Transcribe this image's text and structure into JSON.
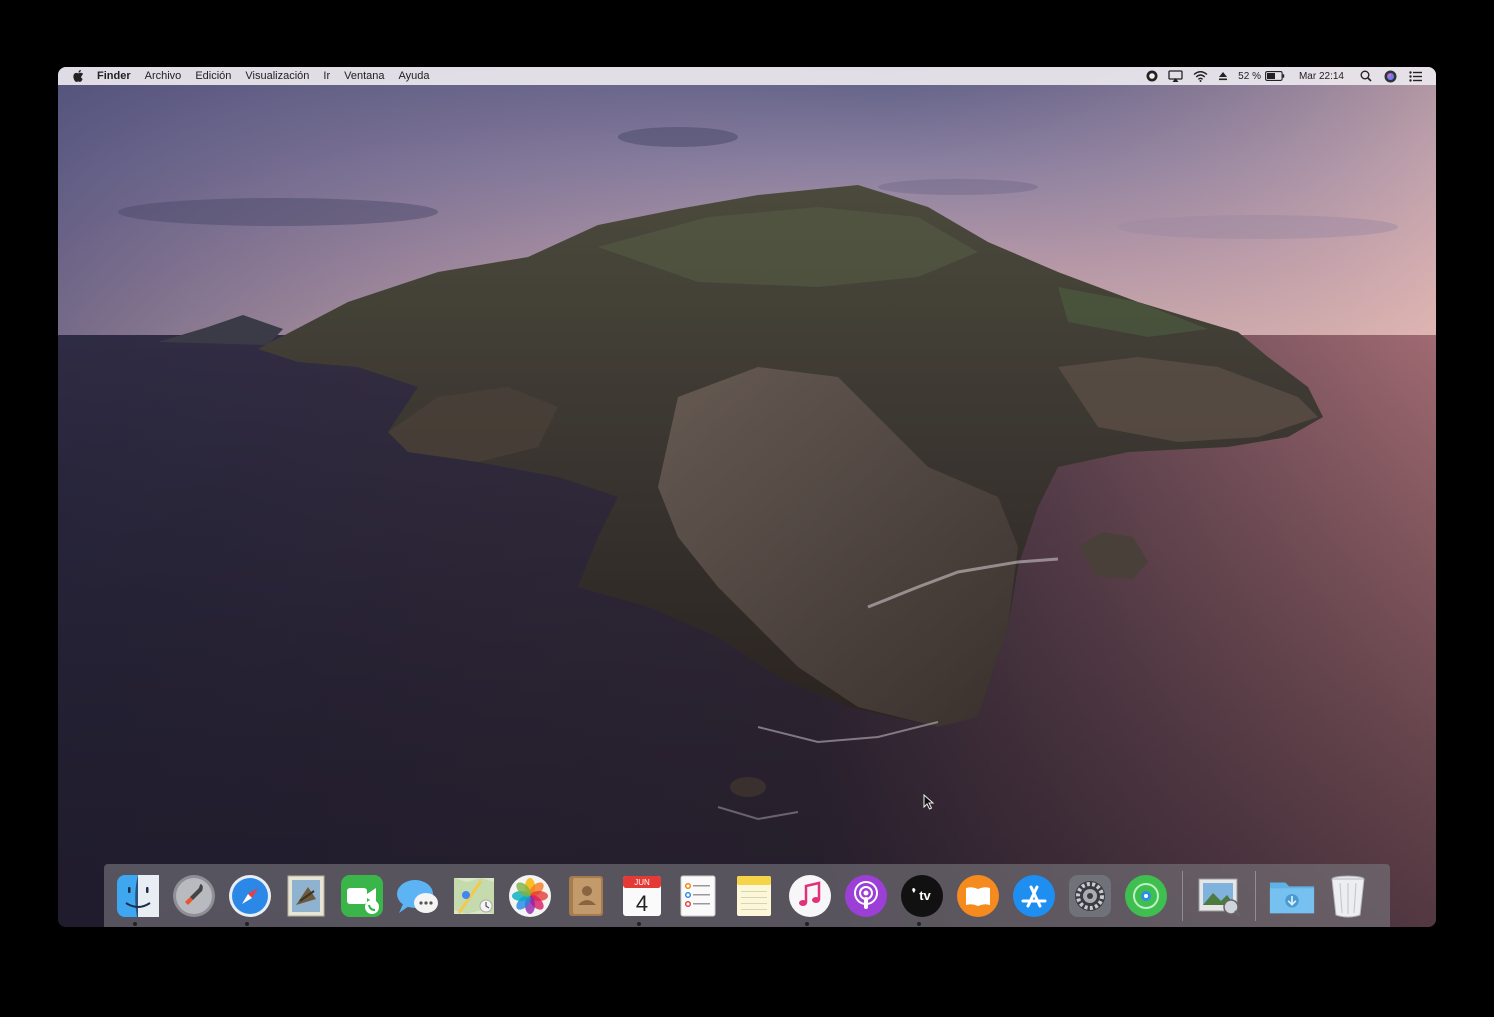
{
  "menubar": {
    "apple_icon": "apple-logo-icon",
    "app_name": "Finder",
    "menus": [
      "Archivo",
      "Edición",
      "Visualización",
      "Ir",
      "Ventana",
      "Ayuda"
    ],
    "status": {
      "battery_percent": "52 %",
      "clock": "Mar 22:14"
    }
  },
  "dock": {
    "apps": [
      {
        "name": "Finder",
        "icon": "finder-icon",
        "running": true
      },
      {
        "name": "Launchpad",
        "icon": "launchpad-icon",
        "running": false
      },
      {
        "name": "Safari",
        "icon": "safari-icon",
        "running": true
      },
      {
        "name": "Mail",
        "icon": "mail-icon",
        "running": false
      },
      {
        "name": "FaceTime",
        "icon": "facetime-icon",
        "running": false
      },
      {
        "name": "Messages",
        "icon": "messages-icon",
        "running": false
      },
      {
        "name": "Maps",
        "icon": "maps-icon",
        "running": false
      },
      {
        "name": "Photos",
        "icon": "photos-icon",
        "running": false
      },
      {
        "name": "Contacts",
        "icon": "contacts-icon",
        "running": false
      },
      {
        "name": "Calendar",
        "icon": "calendar-icon",
        "running": true
      },
      {
        "name": "Reminders",
        "icon": "reminders-icon",
        "running": false
      },
      {
        "name": "Notes",
        "icon": "notes-icon",
        "running": false
      },
      {
        "name": "Music",
        "icon": "music-icon",
        "running": true
      },
      {
        "name": "Podcasts",
        "icon": "podcasts-icon",
        "running": false
      },
      {
        "name": "TV",
        "icon": "apple-tv-icon",
        "running": true
      },
      {
        "name": "Books",
        "icon": "books-icon",
        "running": false
      },
      {
        "name": "App Store",
        "icon": "app-store-icon",
        "running": false
      },
      {
        "name": "System Preferences",
        "icon": "system-preferences-icon",
        "running": false
      },
      {
        "name": "Find My",
        "icon": "find-my-icon",
        "running": false
      }
    ],
    "calendar_month": "JUN",
    "calendar_day": "4",
    "tv_label": "tv"
  },
  "colors": {
    "menubar_bg": "#ece8ee",
    "dock_bg": "#78767d"
  }
}
